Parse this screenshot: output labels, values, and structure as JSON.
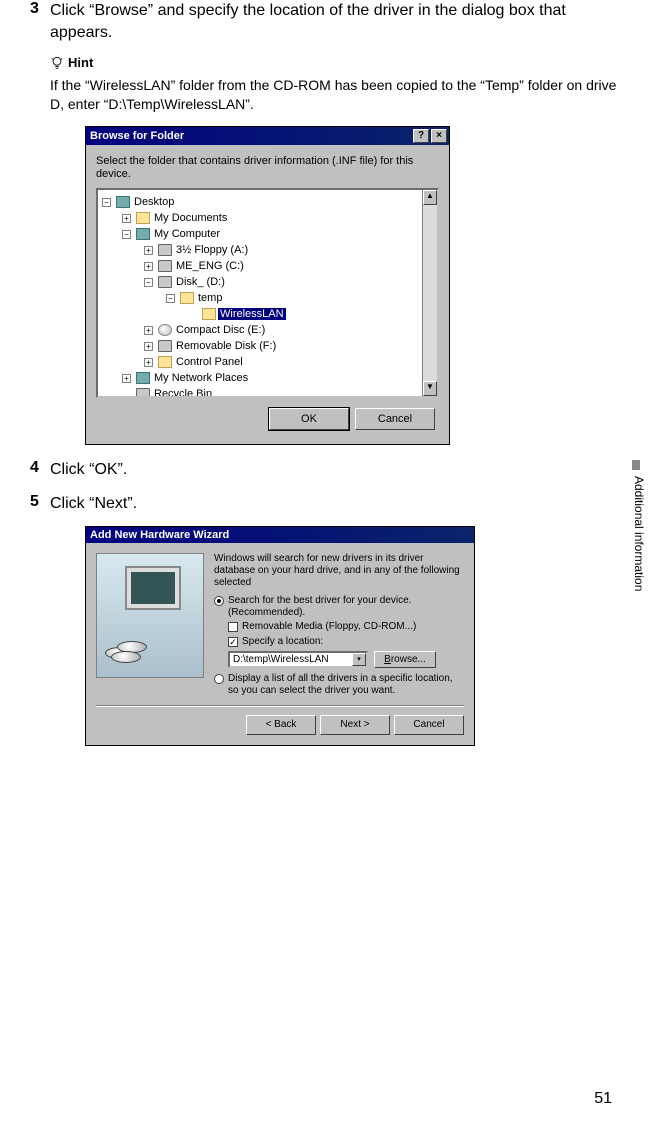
{
  "step3": {
    "num": "3",
    "text": "Click “Browse” and specify the location of the driver in the dialog box that appears."
  },
  "hint": {
    "label": "Hint",
    "body": "If the “WirelessLAN” folder from the CD-ROM has been copied to the “Temp” folder on drive D, enter “D:\\Temp\\WirelessLAN”."
  },
  "browse": {
    "title": "Browse for Folder",
    "help_symbol": "?",
    "close_symbol": "×",
    "msg": "Select the folder that contains driver information (.INF file) for this device.",
    "tree": {
      "desktop": "Desktop",
      "mydocs": "My Documents",
      "mycomputer": "My Computer",
      "floppy": "3½ Floppy (A:)",
      "me_eng": "ME_ENG (C:)",
      "disk_d": "Disk_ (D:)",
      "temp": "temp",
      "wirelesslan": "WirelessLAN",
      "cd": "Compact Disc (E:)",
      "removable": "Removable Disk (F:)",
      "control_panel": "Control Panel",
      "netplaces": "My Network Places",
      "recycle": "Recycle Bin"
    },
    "scroll_up": "▲",
    "scroll_down": "▼",
    "ok": "OK",
    "cancel": "Cancel"
  },
  "step4": {
    "num": "4",
    "text": "Click “OK”."
  },
  "step5": {
    "num": "5",
    "text": "Click “Next”."
  },
  "wizard": {
    "title": "Add New Hardware Wizard",
    "msg": "Windows will search for new drivers in its driver database on your hard drive, and in any of the following selected",
    "opt1": "Search for the best driver for your device. (Recommended).",
    "chk1": "Removable Media (Floppy, CD-ROM...)",
    "chk2": "Specify a location:",
    "location": "D:\\temp\\WirelessLAN",
    "combo_arrow": "▾",
    "browse": "Browse...",
    "opt2": "Display a list of all the drivers in a specific location, so you can select the driver you want.",
    "back": "< Back",
    "next": "Next >",
    "cancel": "Cancel"
  },
  "side_tab": "Additional information",
  "page_num": "51",
  "expander": {
    "plus": "+",
    "minus": "−"
  }
}
